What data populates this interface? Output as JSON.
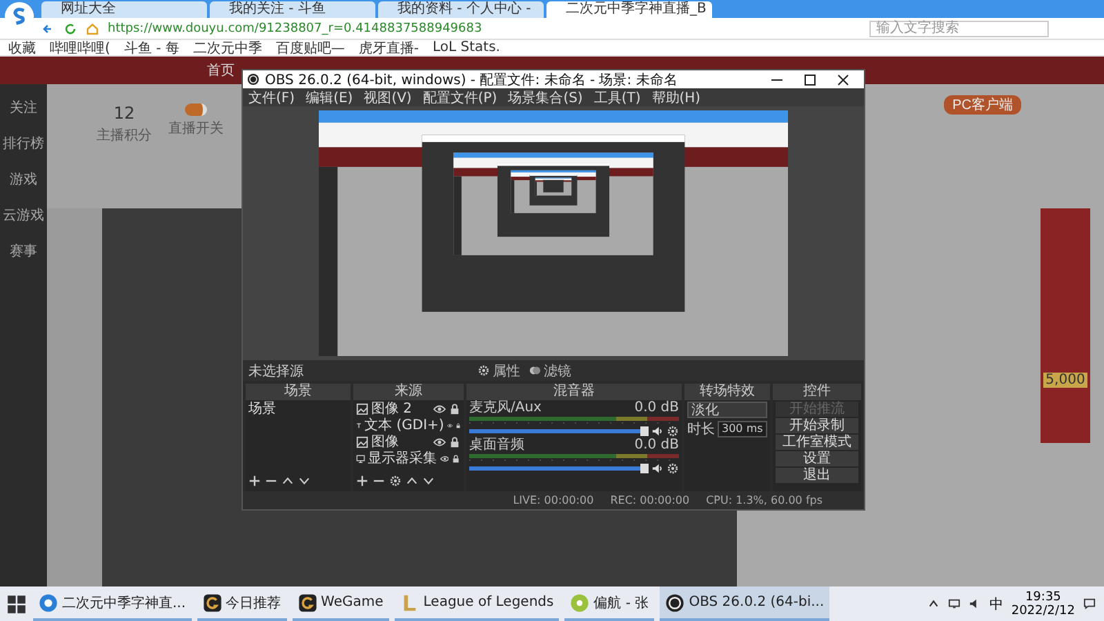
{
  "browser": {
    "tabs": [
      {
        "label": "网址大全",
        "selected": false
      },
      {
        "label": "我的关注 - 斗鱼",
        "selected": false
      },
      {
        "label": "我的资料 - 个人中心 -",
        "selected": false
      },
      {
        "label": "二次元中季字神直播_B",
        "selected": true
      }
    ],
    "address": "https://www.douyu.com/91238807_r=0.4148837588949683",
    "search_placeholder": "输入文字搜索",
    "bookmarks": [
      "收藏",
      "哔哩哔哩(",
      "斗鱼 - 每",
      "二次元中季",
      "百度贴吧—",
      "虎牙直播-",
      "LoL Stats."
    ]
  },
  "page": {
    "nav": "首页",
    "sidebar": [
      "关注",
      "排行榜",
      "游戏",
      "云游戏",
      "赛事"
    ],
    "stats": [
      {
        "value": "12",
        "label": "主播积分"
      },
      {
        "label": "直播开关",
        "on": true
      }
    ],
    "client_button": "PC客户端",
    "ad_amount": "5,000"
  },
  "obs": {
    "title": "OBS 26.0.2 (64-bit, windows) - 配置文件: 未命名 - 场景: 未命名",
    "menu": [
      "文件(F)",
      "编辑(E)",
      "视图(V)",
      "配置文件(P)",
      "场景集合(S)",
      "工具(T)",
      "帮助(H)"
    ],
    "source_status": "未选择源",
    "source_buttons": [
      {
        "kind": "properties",
        "label": "属性"
      },
      {
        "kind": "filters",
        "label": "滤镜"
      }
    ],
    "docks": [
      "场景",
      "来源",
      "混音器",
      "转场特效",
      "控件"
    ],
    "scenes": [
      {
        "label": "场景",
        "selected": false
      }
    ],
    "sources": [
      {
        "kind": "image",
        "label": "图像 2"
      },
      {
        "kind": "text",
        "label": "文本 (GDI+)"
      },
      {
        "kind": "image",
        "label": "图像"
      },
      {
        "kind": "display",
        "label": "显示器采集"
      }
    ],
    "mixer": [
      {
        "name": "麦克风/Aux",
        "reading": "0.0 dB",
        "level": 1
      },
      {
        "name": "桌面音频",
        "reading": "0.0 dB",
        "level": 1
      }
    ],
    "transition": {
      "type": "淡化",
      "duration_label": "时长",
      "duration": "300 ms"
    },
    "controls": [
      {
        "label": "开始推流",
        "disabled": true
      },
      {
        "label": "开始录制",
        "disabled": false
      },
      {
        "label": "工作室模式",
        "disabled": false
      },
      {
        "label": "设置",
        "disabled": false
      },
      {
        "label": "退出",
        "disabled": false
      }
    ],
    "status": [
      "LIVE: 00:00:00",
      "REC: 00:00:00",
      "CPU: 1.3%, 60.00 fps"
    ]
  },
  "taskbar": {
    "items": [
      {
        "label": "二次元中季字神直...",
        "kind": "browser",
        "selected": false
      },
      {
        "label": "今日推荐",
        "kind": "game",
        "selected": false
      },
      {
        "label": "WeGame",
        "kind": "game",
        "selected": false
      },
      {
        "label": "League of Legends",
        "kind": "lol",
        "selected": false
      },
      {
        "label": "偏航 - 张",
        "kind": "music",
        "selected": false
      },
      {
        "label": "OBS 26.0.2 (64-bi...",
        "kind": "obs",
        "selected": true
      }
    ],
    "ime": "中",
    "time": "19:35",
    "date": "2022/2/12"
  }
}
